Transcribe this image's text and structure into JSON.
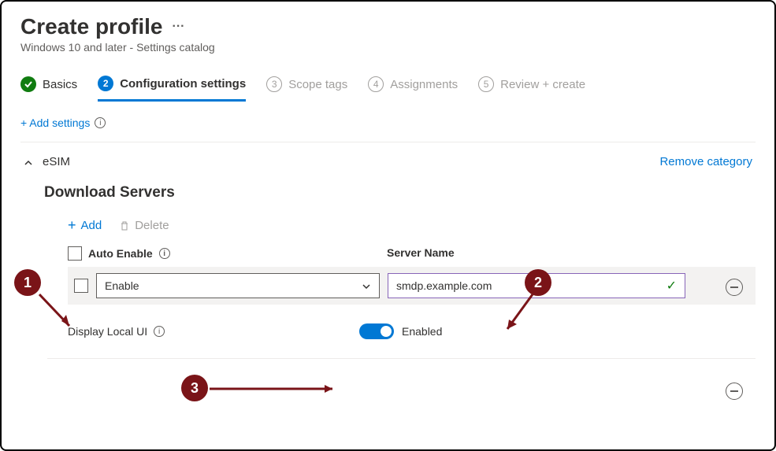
{
  "page": {
    "title": "Create profile",
    "more": "···",
    "subtitle": "Windows 10 and later - Settings catalog"
  },
  "steps": {
    "s1": {
      "num_icon": "check",
      "label": "Basics"
    },
    "s2": {
      "num": "2",
      "label": "Configuration settings"
    },
    "s3": {
      "num": "3",
      "label": "Scope tags"
    },
    "s4": {
      "num": "4",
      "label": "Assignments"
    },
    "s5": {
      "num": "5",
      "label": "Review + create"
    }
  },
  "links": {
    "add_settings": "+ Add settings",
    "remove_category": "Remove category"
  },
  "section": {
    "name": "eSIM",
    "subsection": "Download Servers",
    "toolbar": {
      "add": "Add",
      "delete": "Delete"
    },
    "columns": {
      "auto_enable": "Auto Enable",
      "server_name": "Server Name"
    },
    "row": {
      "auto_enable_value": "Enable",
      "server_name_value": "smdp.example.com"
    },
    "local_ui": {
      "label": "Display Local UI",
      "state": "Enabled"
    }
  },
  "annotations": {
    "a1": "1",
    "a2": "2",
    "a3": "3"
  }
}
